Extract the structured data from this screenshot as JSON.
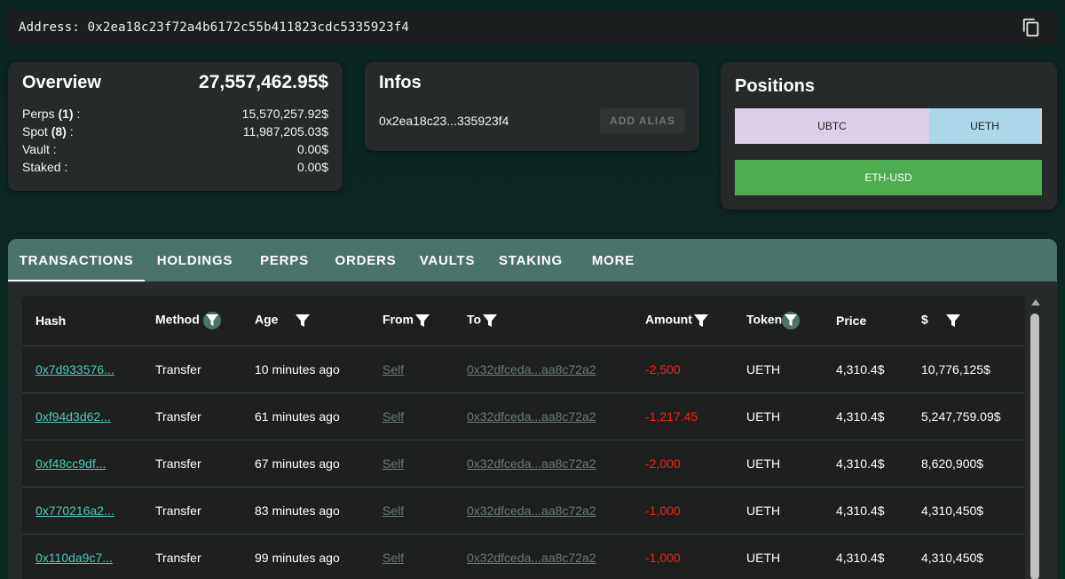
{
  "address_bar": {
    "label": "Address: 0x2ea18c23f72a4b6172c55b411823cdc5335923f4",
    "copy_icon": "copy-icon"
  },
  "overview": {
    "title": "Overview",
    "total": "27,557,462.95$",
    "rows": [
      {
        "label": "Perps",
        "count": "(1)",
        "suffix": " :",
        "value": "15,570,257.92$"
      },
      {
        "label": "Spot",
        "count": "(8)",
        "suffix": " :",
        "value": "11,987,205.03$"
      },
      {
        "label": "Vault :",
        "value": "0.00$"
      },
      {
        "label": "Staked :",
        "value": "0.00$"
      }
    ]
  },
  "infos": {
    "title": "Infos",
    "address_short": "0x2ea18c23...335923f4",
    "alias_button": "ADD ALIAS"
  },
  "positions": {
    "title": "Positions",
    "bar": [
      {
        "label": "UBTC",
        "color": "#dccfe9"
      },
      {
        "label": "UETH",
        "color": "#acd7ea"
      }
    ],
    "perp": {
      "label": "ETH-USD",
      "color": "#4cae4f"
    }
  },
  "tabs": [
    "TRANSACTIONS",
    "HOLDINGS",
    "PERPS",
    "ORDERS",
    "VAULTS",
    "STAKING",
    "MORE"
  ],
  "active_tab": "TRANSACTIONS",
  "table": {
    "headers": [
      "Hash",
      "Method",
      "Age",
      "From",
      "To",
      "Amount",
      "Token",
      "Price",
      "$"
    ],
    "rows": [
      {
        "hash": "0x7d933576...",
        "method": "Transfer",
        "age": "10 minutes ago",
        "from": "Self",
        "to": "0x32dfceda...aa8c72a2",
        "amount": "-2,500",
        "token": "UETH",
        "price": "4,310.4$",
        "usd": "10,776,125$"
      },
      {
        "hash": "0xf94d3d62...",
        "method": "Transfer",
        "age": "61 minutes ago",
        "from": "Self",
        "to": "0x32dfceda...aa8c72a2",
        "amount": "-1,217.45",
        "token": "UETH",
        "price": "4,310.4$",
        "usd": "5,247,759.09$"
      },
      {
        "hash": "0xf48cc9df...",
        "method": "Transfer",
        "age": "67 minutes ago",
        "from": "Self",
        "to": "0x32dfceda...aa8c72a2",
        "amount": "-2,000",
        "token": "UETH",
        "price": "4,310.4$",
        "usd": "8,620,900$"
      },
      {
        "hash": "0x770216a2...",
        "method": "Transfer",
        "age": "83 minutes ago",
        "from": "Self",
        "to": "0x32dfceda...aa8c72a2",
        "amount": "-1,000",
        "token": "UETH",
        "price": "4,310.4$",
        "usd": "4,310,450$"
      },
      {
        "hash": "0x110da9c7...",
        "method": "Transfer",
        "age": "99 minutes ago",
        "from": "Self",
        "to": "0x32dfceda...aa8c72a2",
        "amount": "-1,000",
        "token": "UETH",
        "price": "4,310.4$",
        "usd": "4,310,450$"
      }
    ]
  },
  "colors": {
    "accent_tab": "#4a7469",
    "link": "#4fc9b4",
    "negative": "#e8251b"
  }
}
